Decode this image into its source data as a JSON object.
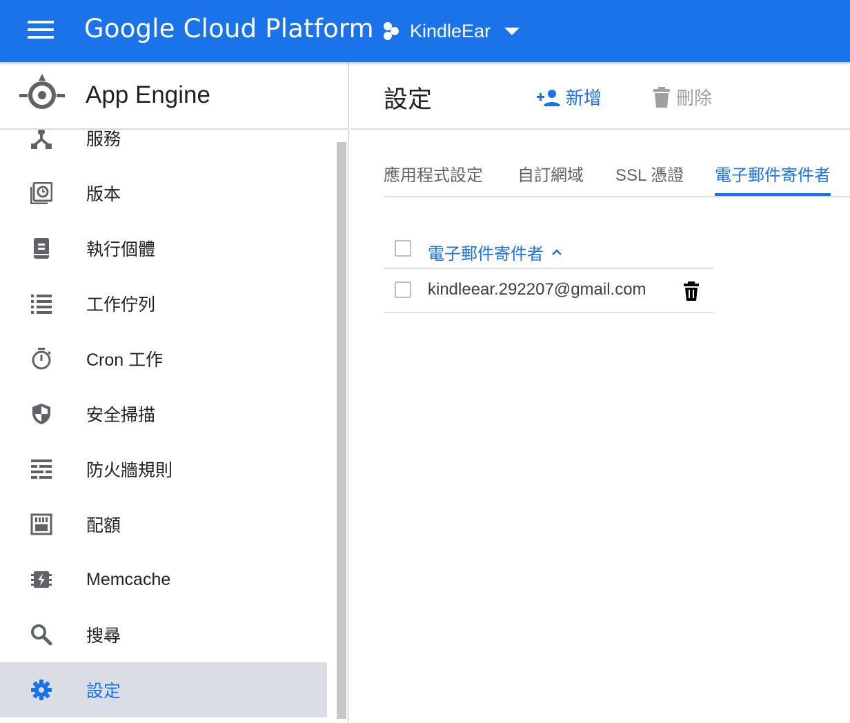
{
  "topbar": {
    "brand": "Google Cloud Platform",
    "project": "KindleEar"
  },
  "sidebar": {
    "title": "App Engine",
    "items": [
      {
        "label": "服務",
        "icon": "services-icon"
      },
      {
        "label": "版本",
        "icon": "versions-icon"
      },
      {
        "label": "執行個體",
        "icon": "instances-icon"
      },
      {
        "label": "工作佇列",
        "icon": "task-queues-icon"
      },
      {
        "label": "Cron 工作",
        "icon": "timer-icon"
      },
      {
        "label": "安全掃描",
        "icon": "shield-icon"
      },
      {
        "label": "防火牆規則",
        "icon": "firewall-icon"
      },
      {
        "label": "配額",
        "icon": "quota-icon"
      },
      {
        "label": "Memcache",
        "icon": "memcache-icon"
      },
      {
        "label": "搜尋",
        "icon": "search-icon"
      },
      {
        "label": "設定",
        "icon": "gear-icon",
        "active": true
      }
    ]
  },
  "main": {
    "title": "設定",
    "add_label": "新增",
    "delete_label": "刪除",
    "tabs": [
      {
        "label": "應用程式設定"
      },
      {
        "label": "自訂網域"
      },
      {
        "label": "SSL 憑證"
      },
      {
        "label": "電子郵件寄件者",
        "active": true
      }
    ],
    "table": {
      "column": "電子郵件寄件者",
      "rows": [
        {
          "email": "kindleear.292207@gmail.com"
        }
      ]
    }
  },
  "colors": {
    "brand_blue": "#1a73e8",
    "active_nav_bg": "#dadde4"
  }
}
